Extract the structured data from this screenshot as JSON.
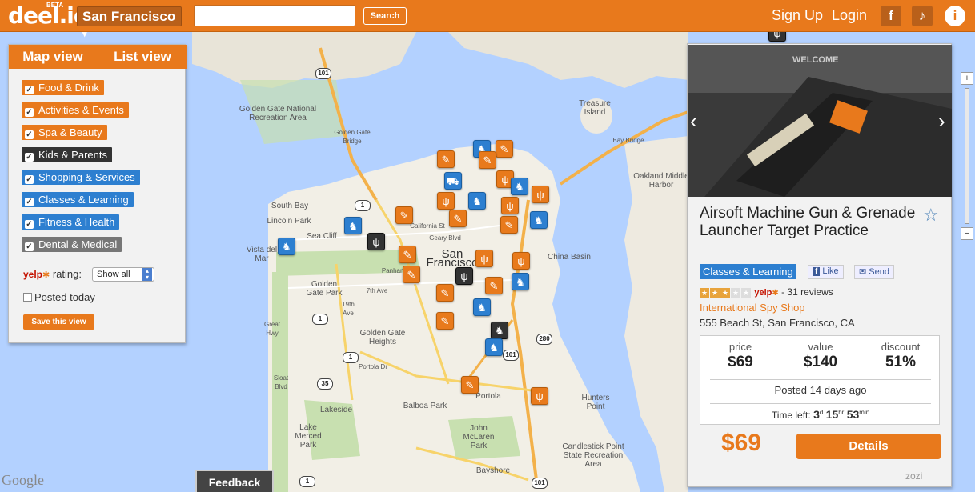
{
  "header": {
    "logo": "deel.io",
    "logo_beta": "BETA",
    "city": "San Francisco",
    "search_placeholder": "",
    "search_button": "Search",
    "sign_up": "Sign Up",
    "login": "Login",
    "icons": [
      "facebook-icon",
      "twitter-icon",
      "info-icon"
    ]
  },
  "left_panel": {
    "tabs": {
      "map": "Map view",
      "list": "List view"
    },
    "categories": [
      {
        "label": "Food & Drink",
        "color": "#e8791c"
      },
      {
        "label": "Activities & Events",
        "color": "#e8791c"
      },
      {
        "label": "Spa & Beauty",
        "color": "#e8791c"
      },
      {
        "label": "Kids & Parents",
        "color": "#333333"
      },
      {
        "label": "Shopping & Services",
        "color": "#2d7fd0"
      },
      {
        "label": "Classes & Learning",
        "color": "#2d7fd0"
      },
      {
        "label": "Fitness & Health",
        "color": "#2d7fd0"
      },
      {
        "label": "Dental & Medical",
        "color": "#777777"
      }
    ],
    "yelp_label": "yelp",
    "rating_label": "rating:",
    "rating_value": "Show all",
    "posted_today": "Posted today",
    "save_view": "Save this view"
  },
  "map": {
    "labels": [
      "Golden Gate National Recreation Area",
      "Treasure Island",
      "Oakland Middle Harbor",
      "South Bay",
      "Lincoln Park",
      "Sea Cliff",
      "Vista del Mar",
      "San Francisco",
      "China Basin",
      "Golden Gate Park",
      "Golden Gate Heights",
      "Lakeside",
      "Lake Merced Park",
      "Balboa Park",
      "Portola",
      "Hunters Point",
      "John McLaren Park",
      "Bayshore",
      "Candlestick Point State Recreation Area",
      "California St",
      "Geary Blvd",
      "Panhandle",
      "Great Hwy",
      "19th Ave",
      "7th Ave",
      "Portola Dr",
      "Sloat Blvd",
      "Bay Bridge",
      "Golden Gate Bridge"
    ],
    "shields": [
      "101",
      "1",
      "1",
      "1",
      "1",
      "35",
      "101",
      "280",
      "101"
    ],
    "google": "Google"
  },
  "deal": {
    "title": "Airsoft Machine Gun & Grenade Launcher Target Practice",
    "category": "Classes & Learning",
    "like": "Like",
    "send": "Send",
    "reviews": "- 31 reviews",
    "yelp_rating": 3,
    "merchant": "International Spy Shop",
    "address": "555 Beach St, San Francisco, CA",
    "price_label": "price",
    "price": "$69",
    "value_label": "value",
    "value": "$140",
    "discount_label": "discount",
    "discount": "51%",
    "posted": "Posted 14 days ago",
    "time_left_label": "Time left:",
    "time_d": "3",
    "time_h": "15",
    "time_m": "53",
    "unit_d": "d",
    "unit_h": "hr",
    "unit_m": "min",
    "big_price": "$69",
    "details_button": "Details",
    "provider": "zozi",
    "image_sign": "WELCOME"
  },
  "feedback": "Feedback"
}
